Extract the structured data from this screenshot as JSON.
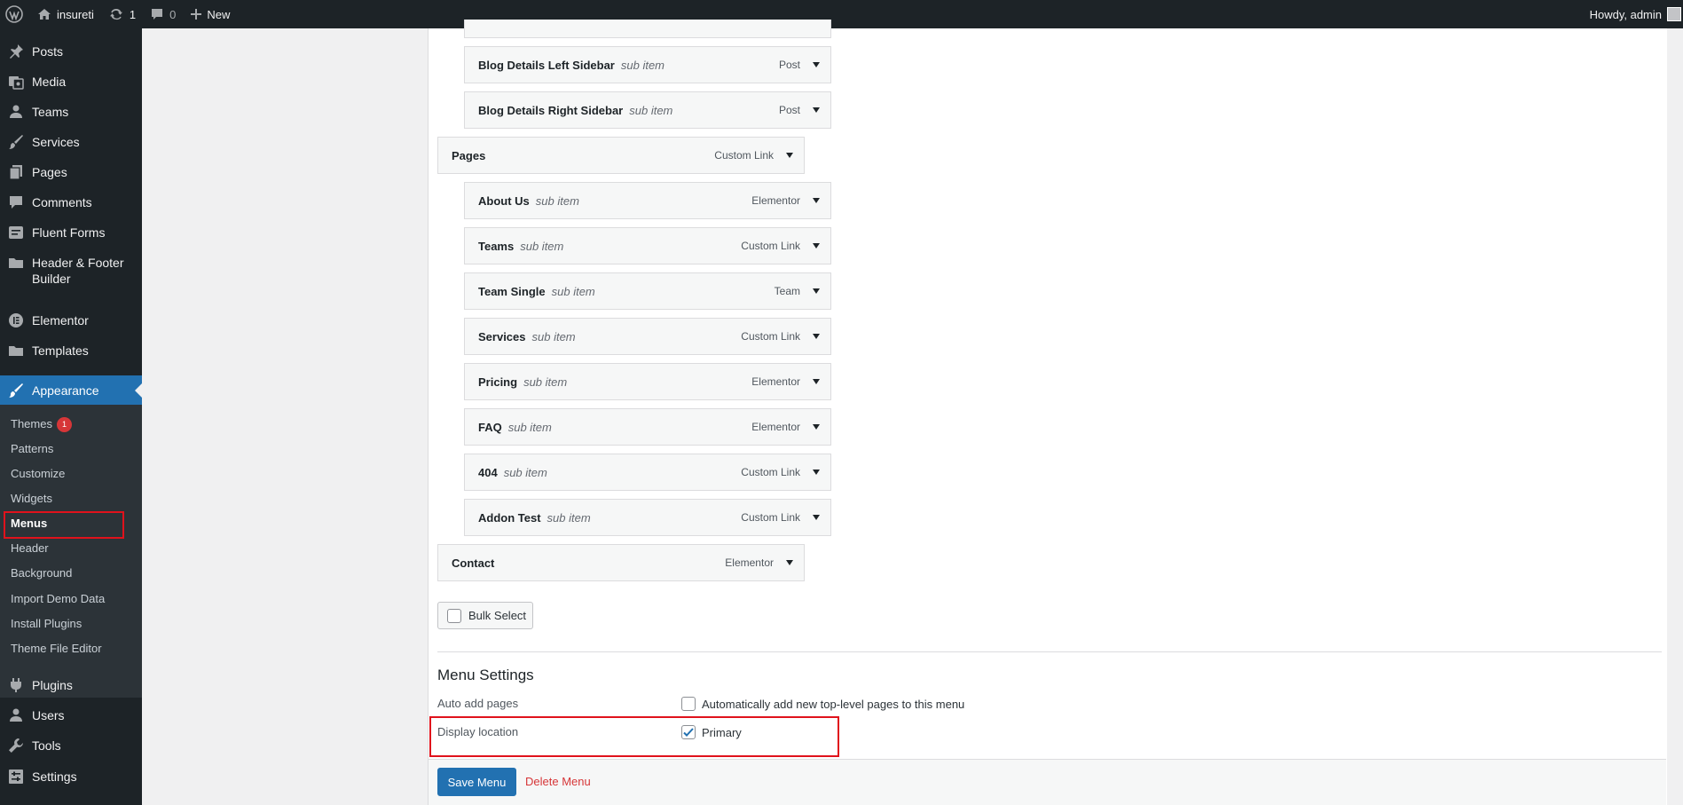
{
  "adminbar": {
    "site_name": "insureti",
    "updates_count": "1",
    "comments_count": "0",
    "new_label": "New",
    "howdy": "Howdy, admin"
  },
  "sidebar": {
    "items": [
      {
        "label": "Posts",
        "icon": "pin-icon"
      },
      {
        "label": "Media",
        "icon": "media-icon"
      },
      {
        "label": "Teams",
        "icon": "person-icon"
      },
      {
        "label": "Services",
        "icon": "brush-icon"
      },
      {
        "label": "Pages",
        "icon": "pages-icon"
      },
      {
        "label": "Comments",
        "icon": "comment-icon"
      },
      {
        "label": "Fluent Forms",
        "icon": "form-icon"
      },
      {
        "label": "Header & Footer Builder",
        "icon": "folder-icon"
      },
      {
        "label": "Elementor",
        "icon": "elementor-icon"
      },
      {
        "label": "Templates",
        "icon": "folder-icon"
      },
      {
        "label": "Appearance",
        "icon": "brush-icon"
      },
      {
        "label": "Plugins",
        "icon": "plugin-icon"
      },
      {
        "label": "Users",
        "icon": "person-icon"
      },
      {
        "label": "Tools",
        "icon": "wrench-icon"
      },
      {
        "label": "Settings",
        "icon": "settings-icon"
      }
    ],
    "appearance_sub": [
      {
        "label": "Themes",
        "badge": "1"
      },
      {
        "label": "Patterns"
      },
      {
        "label": "Customize"
      },
      {
        "label": "Widgets"
      },
      {
        "label": "Menus"
      },
      {
        "label": "Header"
      },
      {
        "label": "Background"
      },
      {
        "label": "Import Demo Data"
      },
      {
        "label": "Install Plugins"
      },
      {
        "label": "Theme File Editor"
      }
    ]
  },
  "menu_items": [
    {
      "title": "Blog Details Left Sidebar",
      "sub": "sub item",
      "type": "Post"
    },
    {
      "title": "Blog Details Right Sidebar",
      "sub": "sub item",
      "type": "Post"
    },
    {
      "title": "Pages",
      "sub": "",
      "type": "Custom Link"
    },
    {
      "title": "About Us",
      "sub": "sub item",
      "type": "Elementor"
    },
    {
      "title": "Teams",
      "sub": "sub item",
      "type": "Custom Link"
    },
    {
      "title": "Team Single",
      "sub": "sub item",
      "type": "Team"
    },
    {
      "title": "Services",
      "sub": "sub item",
      "type": "Custom Link"
    },
    {
      "title": "Pricing",
      "sub": "sub item",
      "type": "Elementor"
    },
    {
      "title": "FAQ",
      "sub": "sub item",
      "type": "Elementor"
    },
    {
      "title": "404",
      "sub": "sub item",
      "type": "Custom Link"
    },
    {
      "title": "Addon Test",
      "sub": "sub item",
      "type": "Custom Link"
    },
    {
      "title": "Contact",
      "sub": "",
      "type": "Elementor"
    }
  ],
  "bulk_select_label": "Bulk Select",
  "menu_settings": {
    "title": "Menu Settings",
    "auto_add_label": "Auto add pages",
    "auto_add_option": "Automatically add new top-level pages to this menu",
    "auto_add_checked": false,
    "display_location_label": "Display location",
    "primary_option": "Primary",
    "primary_checked": true
  },
  "actions": {
    "save_label": "Save Menu",
    "delete_label": "Delete Menu"
  },
  "colors": {
    "accent": "#2271b1",
    "highlight_box": "#e0121c",
    "delete": "#d63638"
  }
}
